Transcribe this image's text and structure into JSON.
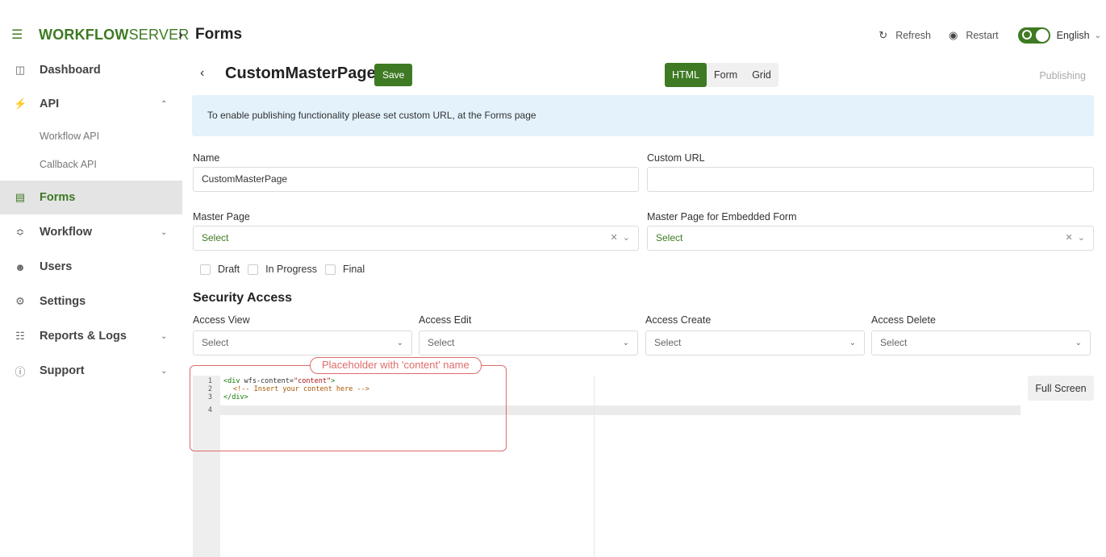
{
  "header": {
    "logo_bold": "WORKFLOW",
    "logo_thin": "SERVER",
    "breadcrumb_sep": "›",
    "breadcrumb_title": "Forms",
    "refresh_label": "Refresh",
    "restart_label": "Restart",
    "language": "English",
    "icons": {
      "menu": "hamburger-icon",
      "refresh": "refresh-icon",
      "restart": "stop-circle-icon",
      "theme": "theme-toggle",
      "lang": "chevron-down-icon"
    }
  },
  "sidebar": {
    "items": [
      {
        "label": "Dashboard",
        "icon": "dashboard-icon"
      },
      {
        "label": "API",
        "icon": "plug-icon",
        "expanded": true
      },
      {
        "label": "Forms",
        "icon": "form-icon",
        "active": true
      },
      {
        "label": "Workflow",
        "icon": "workflow-icon"
      },
      {
        "label": "Users",
        "icon": "users-icon"
      },
      {
        "label": "Settings",
        "icon": "gears-icon"
      },
      {
        "label": "Reports & Logs",
        "icon": "reports-icon"
      },
      {
        "label": "Support",
        "icon": "help-icon"
      }
    ],
    "api_subitems": [
      "Workflow API",
      "Callback API"
    ]
  },
  "main": {
    "title": "CustomMasterPage",
    "save_label": "Save",
    "tabs": [
      "HTML",
      "Form",
      "Grid"
    ],
    "active_tab": "HTML",
    "publishing_label": "Publishing",
    "alert_text": "To enable publishing functionality please set custom URL, at the Forms page",
    "fields": {
      "name_label": "Name",
      "name_value": "CustomMasterPage",
      "custom_url_label": "Custom URL",
      "custom_url_value": "",
      "master_page_label": "Master Page",
      "master_page_value": "Select",
      "master_embedded_label": "Master Page for Embedded Form",
      "master_embedded_value": "Select"
    },
    "statuses": [
      "Draft",
      "In Progress",
      "Final"
    ],
    "security": {
      "title": "Security Access",
      "fields": [
        {
          "label": "Access View",
          "value": "Select"
        },
        {
          "label": "Access Edit",
          "value": "Select"
        },
        {
          "label": "Access Create",
          "value": "Select"
        },
        {
          "label": "Access Delete",
          "value": "Select"
        }
      ]
    },
    "editor": {
      "line_numbers": [
        "1",
        "2",
        "3",
        "4"
      ],
      "line1": {
        "open": "<div ",
        "attr": "wfs-content=",
        "str": "\"content\"",
        "close": ">"
      },
      "line2": "<!-- Insert your content here -->",
      "line3": "</div>",
      "line4": ""
    },
    "fullscreen_label": "Full Screen",
    "annotation": "Placeholder with 'content' name"
  },
  "colors": {
    "accent": "#3e7a23",
    "alert_bg": "#e3f2fb",
    "annotation": "#e06b6b"
  }
}
